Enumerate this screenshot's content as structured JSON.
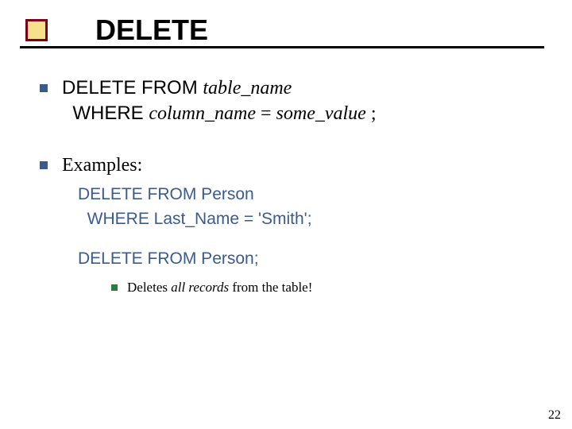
{
  "title": "DELETE",
  "point1": {
    "line1_a": "DELETE FROM ",
    "line1_b_it": "table_name",
    "line2_a": "  WHERE ",
    "line2_b_it": "column_name",
    "line2_c": " = ",
    "line2_d_it": "some_value",
    "line2_e": " ;"
  },
  "point2": "Examples:",
  "ex1_l1": "DELETE FROM Person",
  "ex1_l2": "  WHERE Last_Name = 'Smith';",
  "ex2": "DELETE FROM Person;",
  "note": {
    "a": "Deletes ",
    "b_it": "all records",
    "c": " from the table!"
  },
  "page_number": "22"
}
